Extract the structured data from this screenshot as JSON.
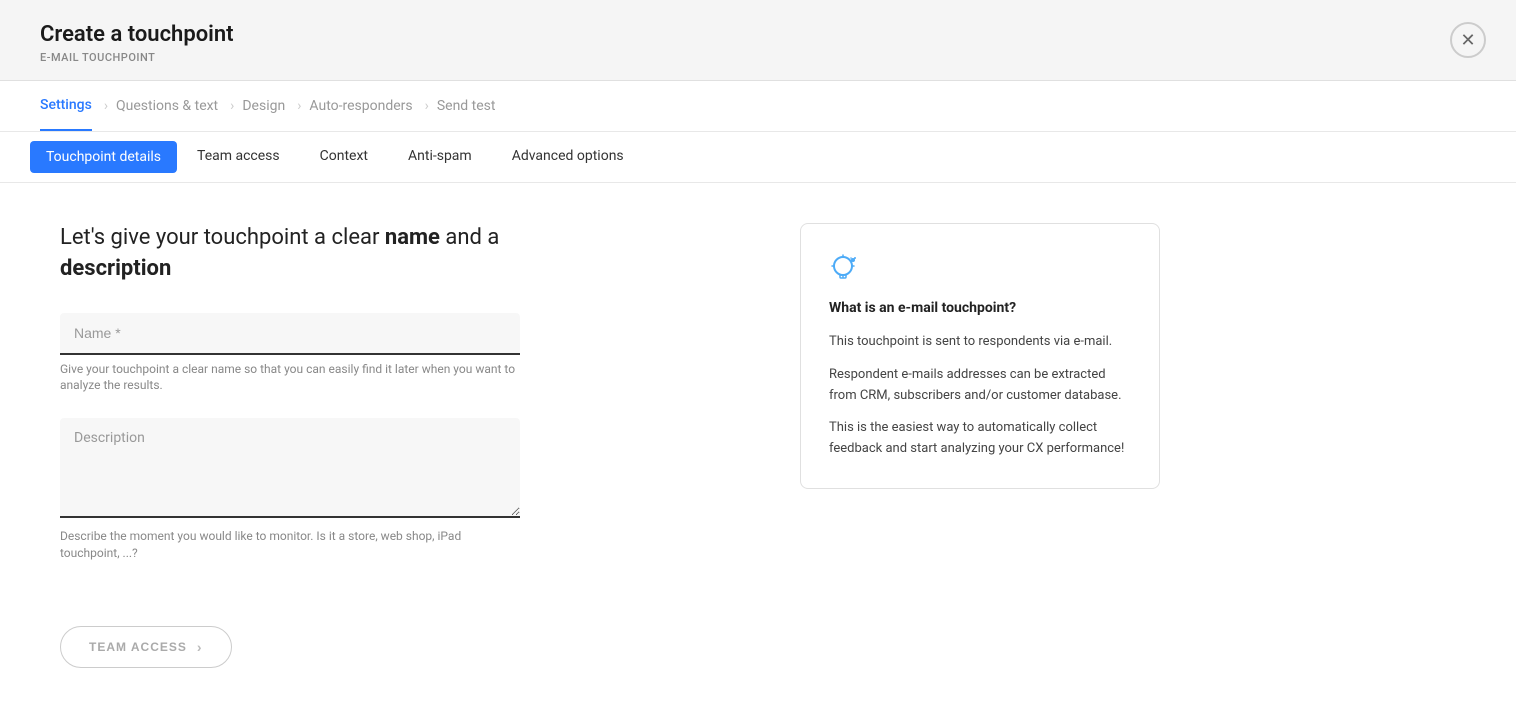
{
  "modal": {
    "title": "Create a touchpoint",
    "subtitle": "E-MAIL TOUCHPOINT",
    "close_label": "×"
  },
  "top_nav": {
    "items": [
      {
        "label": "Settings",
        "active": true
      },
      {
        "label": "Questions & text",
        "active": false
      },
      {
        "label": "Design",
        "active": false
      },
      {
        "label": "Auto-responders",
        "active": false
      },
      {
        "label": "Send test",
        "active": false
      }
    ]
  },
  "sub_tabs": {
    "items": [
      {
        "label": "Touchpoint details",
        "active": true
      },
      {
        "label": "Team access",
        "active": false
      },
      {
        "label": "Context",
        "active": false
      },
      {
        "label": "Anti-spam",
        "active": false
      },
      {
        "label": "Advanced options",
        "active": false
      }
    ]
  },
  "form": {
    "heading_part1": "Let's give your touchpoint a clear ",
    "heading_bold1": "name",
    "heading_part2": " and a ",
    "heading_bold2": "description",
    "name_field": {
      "placeholder": "Name *",
      "hint": "Give your touchpoint a clear name so that you can easily find it later when you want to analyze the results."
    },
    "description_field": {
      "placeholder": "Description",
      "hint": "Describe the moment you would like to monitor. Is it a store, web shop, iPad touchpoint, ...?"
    }
  },
  "info_card": {
    "title": "What is an e-mail touchpoint?",
    "paragraphs": [
      "This touchpoint is sent to respondents via e-mail.",
      "Respondent e-mails addresses can be extracted from CRM, subscribers and/or customer database.",
      "This is the easiest way to automatically collect feedback and start analyzing your CX performance!"
    ]
  },
  "footer": {
    "team_access_button": "TEAM ACCESS"
  }
}
